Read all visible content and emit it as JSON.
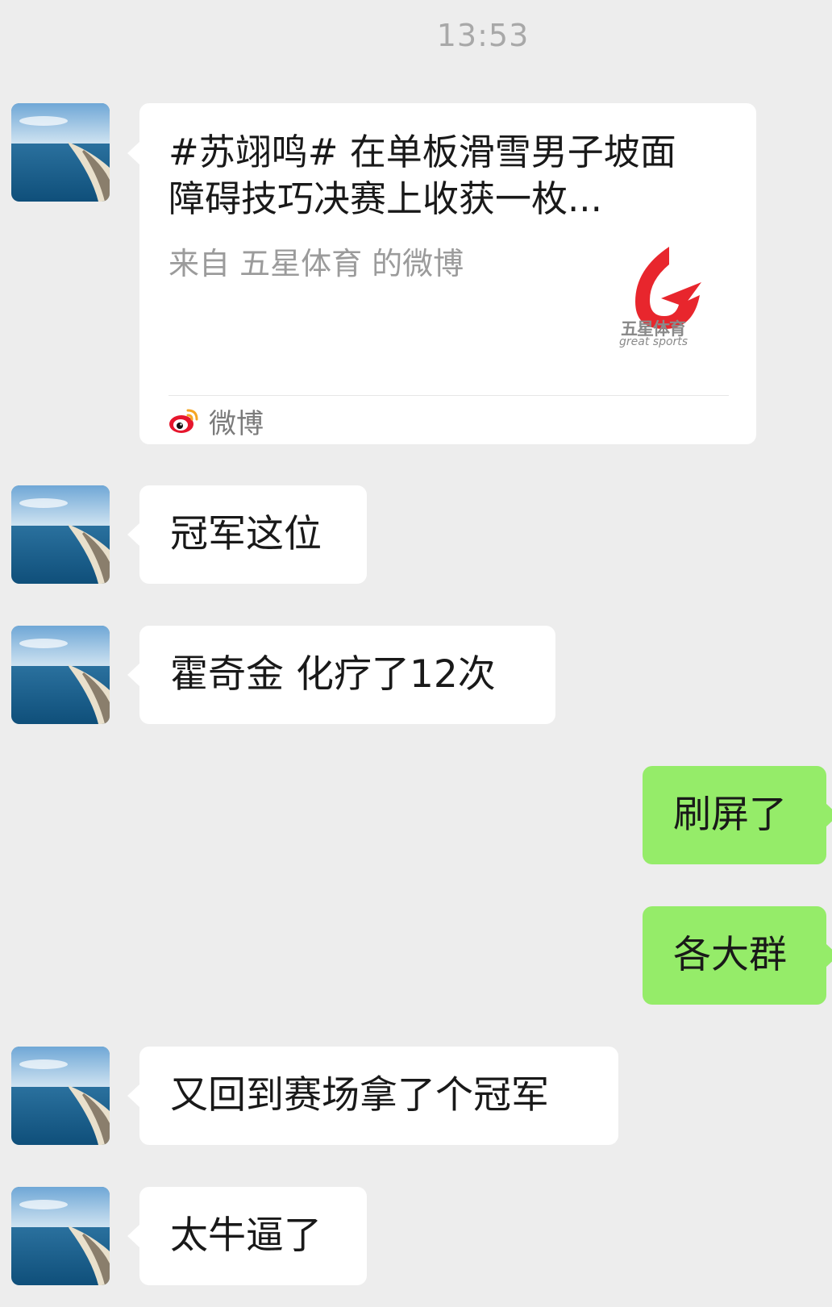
{
  "timestamp": "13:53",
  "share_card": {
    "title": "#苏翊鸣# 在单板滑雪男子坡面障碍技巧决赛上收获一枚...",
    "source": "来自 五星体育 的微博",
    "logo_text": "五星体育",
    "logo_subtext": "great sports",
    "footer_label": "微博",
    "brand_color": "#e8262d",
    "footer_icon": "weibo-icon"
  },
  "messages": [
    {
      "side": "left",
      "text": "冠军这位"
    },
    {
      "side": "left",
      "text": "霍奇金 化疗了12次"
    },
    {
      "side": "right",
      "text": "刷屏了"
    },
    {
      "side": "right",
      "text": "各大群"
    },
    {
      "side": "left",
      "text": "又回到赛场拿了个冠军"
    },
    {
      "side": "left",
      "text": "太牛逼了"
    }
  ],
  "colors": {
    "background": "#ededed",
    "incoming_bubble": "#ffffff",
    "outgoing_bubble": "#95ec69",
    "timestamp": "#a8a8a8"
  }
}
